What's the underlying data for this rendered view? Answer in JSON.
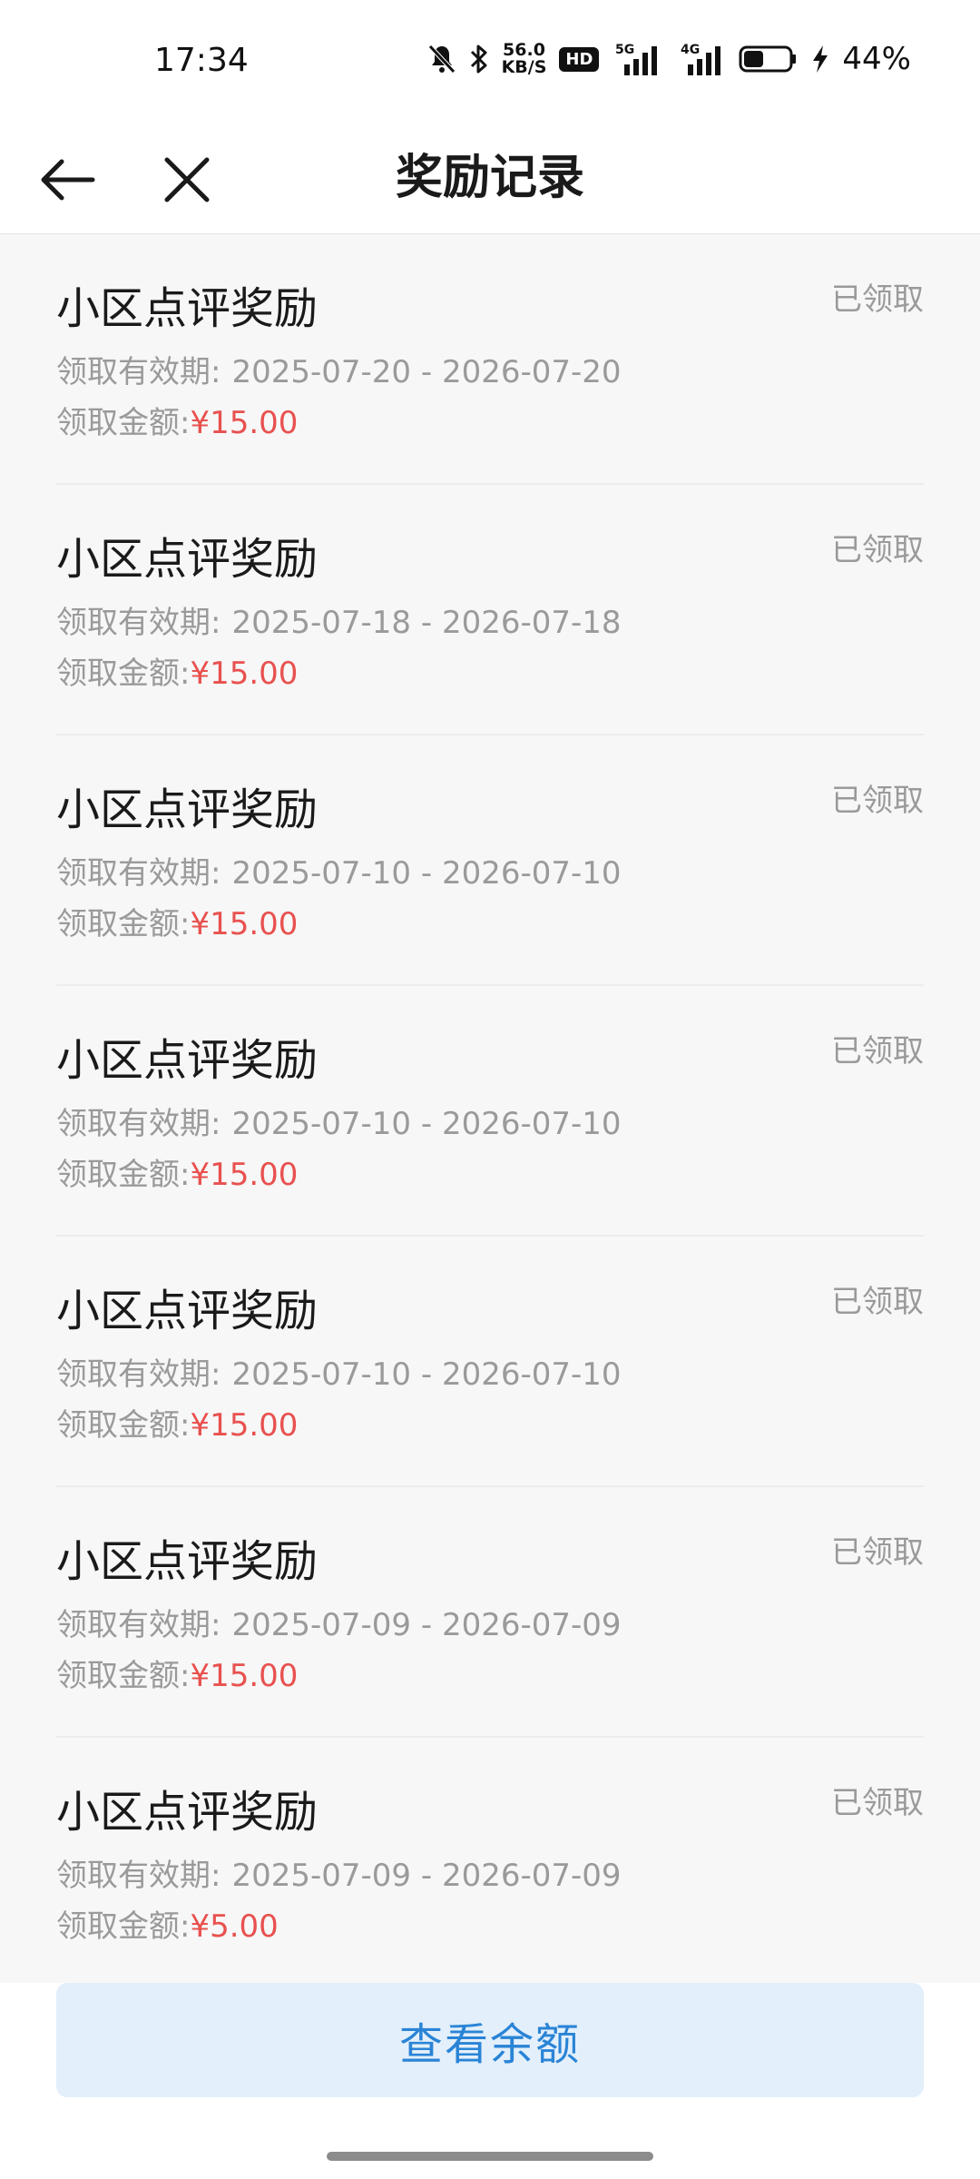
{
  "status_bar": {
    "time": "17:34",
    "net_speed_value": "56.0",
    "net_speed_unit": "KB/S",
    "hd_label": "HD",
    "signal_5g": "5G",
    "signal_4g": "4G",
    "battery_level": 0.44,
    "battery_percent": "44%"
  },
  "header": {
    "title": "奖励记录",
    "back_icon": "arrow-left-icon",
    "close_icon": "close-icon"
  },
  "records": [
    {
      "title": "小区点评奖励",
      "status": "已领取",
      "validity_label": "领取有效期:",
      "validity": "2025-07-20 - 2026-07-20",
      "amount_label": "领取金额:",
      "amount": "¥15.00"
    },
    {
      "title": "小区点评奖励",
      "status": "已领取",
      "validity_label": "领取有效期:",
      "validity": "2025-07-18 - 2026-07-18",
      "amount_label": "领取金额:",
      "amount": "¥15.00"
    },
    {
      "title": "小区点评奖励",
      "status": "已领取",
      "validity_label": "领取有效期:",
      "validity": "2025-07-10 - 2026-07-10",
      "amount_label": "领取金额:",
      "amount": "¥15.00"
    },
    {
      "title": "小区点评奖励",
      "status": "已领取",
      "validity_label": "领取有效期:",
      "validity": "2025-07-10 - 2026-07-10",
      "amount_label": "领取金额:",
      "amount": "¥15.00"
    },
    {
      "title": "小区点评奖励",
      "status": "已领取",
      "validity_label": "领取有效期:",
      "validity": "2025-07-10 - 2026-07-10",
      "amount_label": "领取金额:",
      "amount": "¥15.00"
    },
    {
      "title": "小区点评奖励",
      "status": "已领取",
      "validity_label": "领取有效期:",
      "validity": "2025-07-09 - 2026-07-09",
      "amount_label": "领取金额:",
      "amount": "¥15.00"
    },
    {
      "title": "小区点评奖励",
      "status": "已领取",
      "validity_label": "领取有效期:",
      "validity": "2025-07-09 - 2026-07-09",
      "amount_label": "领取金额:",
      "amount": "¥5.00"
    }
  ],
  "footer": {
    "balance_button": "查看余额"
  },
  "colors": {
    "amount": "#e8514f",
    "button_bg": "#e3effb",
    "button_text": "#2a84d6",
    "list_bg": "#f7f7f7"
  }
}
